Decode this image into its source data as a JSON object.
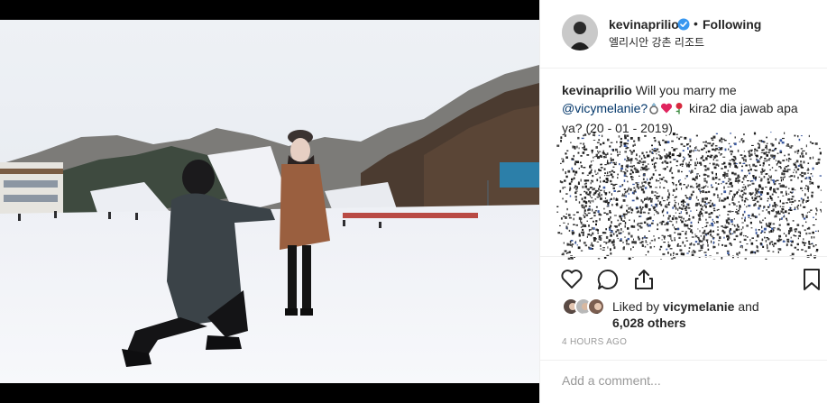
{
  "header": {
    "username": "kevinaprilio",
    "separator": "•",
    "follow_status": "Following",
    "location": "엘리시안 강촌 리조트"
  },
  "caption": {
    "username": "kevinaprilio",
    "text_before_mention": "Will you marry me",
    "mention": "@vicymelanie?",
    "emojis": [
      "ring-emoji",
      "heart-emoji",
      "rose-emoji"
    ],
    "text_after": "kira2 dia jawab apa ya? (20 - 01 - 2019)"
  },
  "actions": {
    "like_icon": "heart-outline-icon",
    "comment_icon": "comment-bubble-icon",
    "share_icon": "share-upload-icon",
    "save_icon": "bookmark-icon"
  },
  "likes": {
    "prefix": "Liked by",
    "first_user": "vicymelanie",
    "conjunction": "and",
    "others": "6,028 others"
  },
  "timestamp": "4 HOURS AGO",
  "comment": {
    "placeholder": "Add a comment..."
  },
  "colors": {
    "verified_blue": "#3897f0",
    "link_blue": "#003569",
    "text": "#262626",
    "muted": "#999999",
    "border": "#efefef"
  }
}
